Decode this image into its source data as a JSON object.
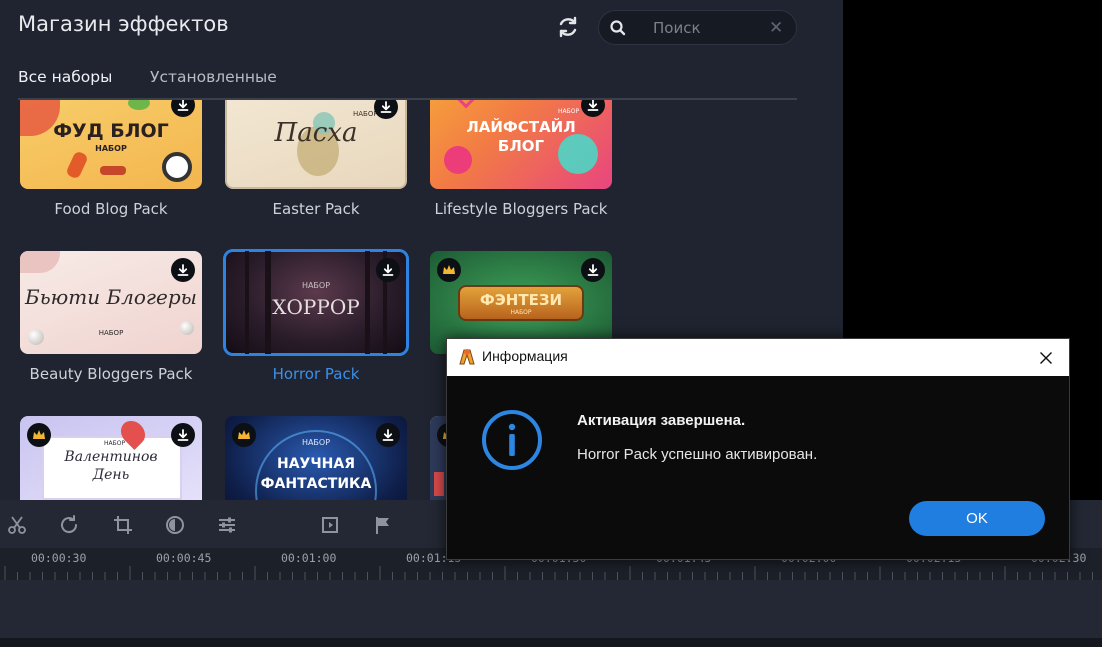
{
  "store": {
    "title": "Магазин эффектов",
    "search_placeholder": "Поиск",
    "tabs": [
      {
        "label": "Все наборы",
        "active": true
      },
      {
        "label": "Установленные",
        "active": false
      }
    ],
    "packs": [
      {
        "name": "Food Blog Pack",
        "thumb_title": "ФУД БЛОГ",
        "thumb_sub": "НАБОР",
        "colors": [
          "#f7cf6b",
          "#f4b54e"
        ]
      },
      {
        "name": "Easter Pack",
        "thumb_title": "Пасха",
        "thumb_sub": "НАБОР",
        "colors": [
          "#f3e8d4",
          "#e8d7bd"
        ]
      },
      {
        "name": "Lifestyle Bloggers Pack",
        "thumb_title": "ЛАЙФСТАЙЛ БЛОГ",
        "thumb_sub": "НАБОР",
        "colors": [
          "#f6a13b",
          "#e8457f"
        ]
      },
      {
        "name": "Beauty Bloggers Pack",
        "thumb_title": "Бьюти Блогеры",
        "thumb_sub": "НАБОР",
        "colors": [
          "#f7ebe7",
          "#f0d3cf"
        ]
      },
      {
        "name": "Horror Pack",
        "thumb_title": "ХОРРОР",
        "thumb_sub": "НАБОР",
        "colors": [
          "#2b1d2b",
          "#3a2230"
        ],
        "selected": true
      },
      {
        "name": "",
        "thumb_title": "ФЭНТЕЗИ",
        "thumb_sub": "НАБОР",
        "colors": [
          "#2f8a4a",
          "#1d5b34"
        ]
      },
      {
        "name": "",
        "thumb_title": "Валентинов День",
        "thumb_sub": "НАБОР",
        "colors": [
          "#c8c4f0",
          "#e9e4fb"
        ]
      },
      {
        "name": "",
        "thumb_title": "НАУЧНАЯ ФАНТАСТИКА",
        "thumb_sub": "НАБОР",
        "colors": [
          "#0f1f4a",
          "#1c3a7a"
        ]
      }
    ]
  },
  "timeline": {
    "timecodes": [
      "00:00:30",
      "00:00:45",
      "00:01:00",
      "00:01:15",
      "00:01:30",
      "00:01:45",
      "00:02:00",
      "00:02:15",
      "00:02:30"
    ]
  },
  "dialog": {
    "title": "Информация",
    "heading": "Активация завершена.",
    "message": "Horror Pack успешно активирован.",
    "ok_label": "OK"
  },
  "colors": {
    "accent": "#1f7ee0",
    "panel": "#1f2430",
    "selection": "#2d83e0"
  }
}
